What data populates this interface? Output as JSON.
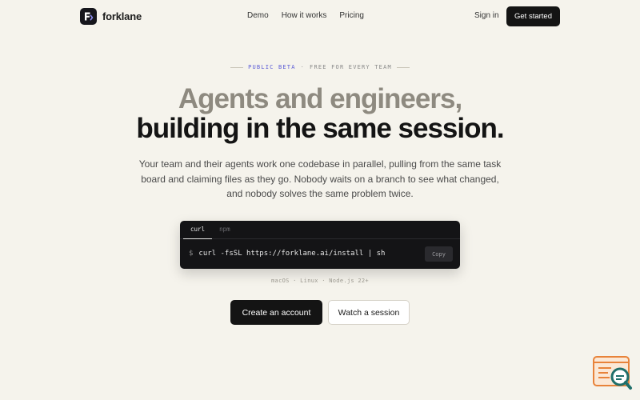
{
  "brand": {
    "name": "forklane",
    "logo_icon": "forklane-logo-icon"
  },
  "nav": {
    "links": [
      {
        "label": "Demo"
      },
      {
        "label": "How it works"
      },
      {
        "label": "Pricing"
      }
    ],
    "sign_in": "Sign in",
    "get_started": "Get started"
  },
  "hero": {
    "eyebrow_beta": "PUBLIC BETA",
    "eyebrow_sep": "·",
    "eyebrow_rest": "FREE FOR EVERY TEAM",
    "headline_line1": "Agents and engineers,",
    "headline_line2": "building in the same session.",
    "subtext": "Your team and their agents work one codebase in parallel, pulling from the same task board and claiming files as they go. Nobody waits on a branch to see what changed, and nobody solves the same problem twice."
  },
  "install": {
    "tabs": [
      {
        "label": "curl"
      },
      {
        "label": "npm"
      }
    ],
    "active_tab": "curl",
    "prompt": "$",
    "command": "curl -fsSL https://forklane.ai/install | sh",
    "copy_label": "Copy",
    "platforms": "macOS · Linux · Node.js 22+"
  },
  "cta": {
    "primary": "Create an account",
    "secondary": "Watch a session"
  },
  "colors": {
    "background": "#f5f3ec",
    "accent": "#5b5bd6",
    "primary_button": "#141414",
    "headline_muted": "#8e8a80",
    "widget_orange": "#e8833a",
    "widget_teal": "#1f6f6a"
  },
  "widget": {
    "icon": "search-document-icon"
  }
}
